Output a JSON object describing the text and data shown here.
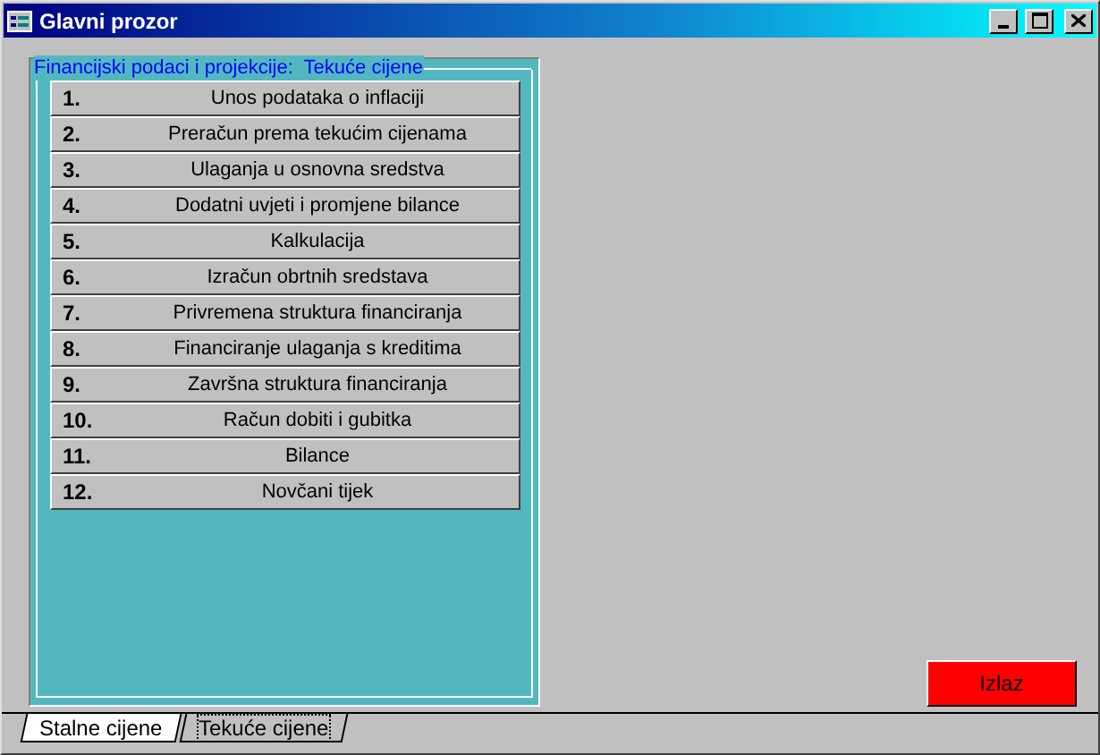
{
  "window": {
    "title": "Glavni prozor"
  },
  "group": {
    "title": "Financijski podaci i projekcije:  Tekuće cijene"
  },
  "menu_items": [
    {
      "number": "1.",
      "label": "Unos podataka o inflaciji"
    },
    {
      "number": "2.",
      "label": "Preračun prema tekućim cijenama"
    },
    {
      "number": "3.",
      "label": "Ulaganja u osnovna sredstva"
    },
    {
      "number": "4.",
      "label": "Dodatni uvjeti i promjene bilance"
    },
    {
      "number": "5.",
      "label": "Kalkulacija"
    },
    {
      "number": "6.",
      "label": "Izračun obrtnih sredstava"
    },
    {
      "number": "7.",
      "label": "Privremena struktura financiranja"
    },
    {
      "number": "8.",
      "label": "Financiranje ulaganja s kreditima"
    },
    {
      "number": "9.",
      "label": "Završna struktura financiranja"
    },
    {
      "number": "10.",
      "label": "Račun dobiti i gubitka"
    },
    {
      "number": "11.",
      "label": "Bilance"
    },
    {
      "number": "12.",
      "label": "Novčani tijek"
    }
  ],
  "exit_button": {
    "label": "Izlaz"
  },
  "sheet_tabs": [
    {
      "label": "Stalne cijene",
      "selected": true
    },
    {
      "label": "Tekuće cijene",
      "selected": false
    }
  ]
}
